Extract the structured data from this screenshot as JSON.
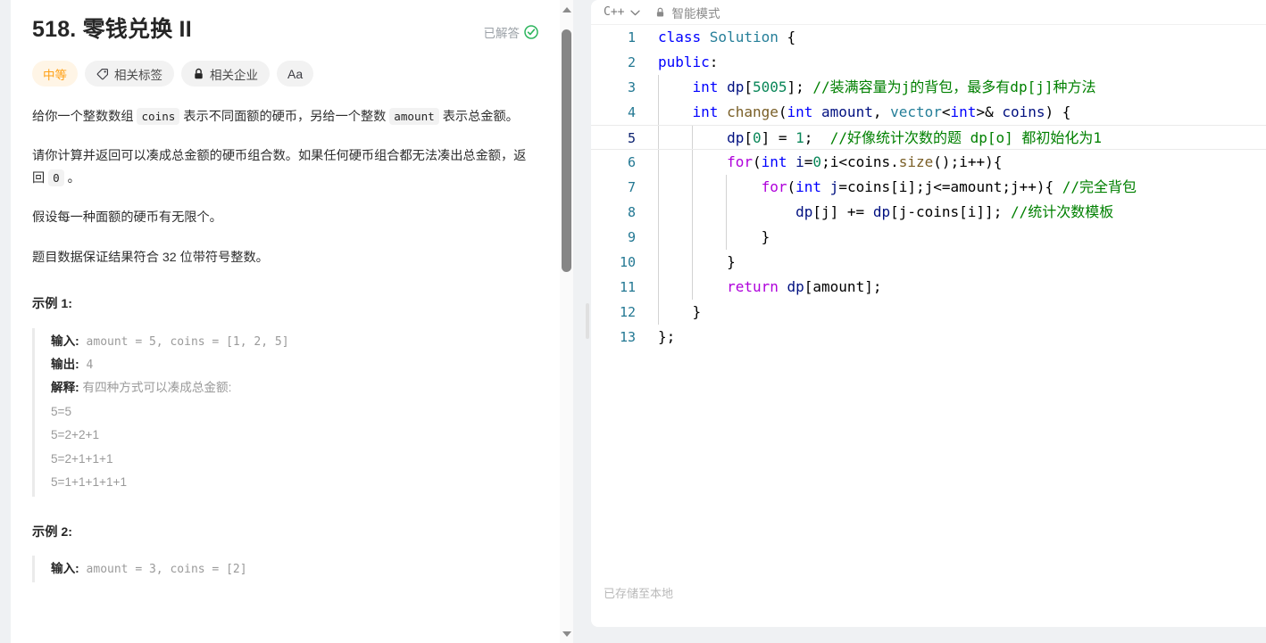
{
  "problem": {
    "title": "518. 零钱兑换 II",
    "solved_label": "已解答",
    "pills": {
      "difficulty": "中等",
      "tags": "相关标签",
      "companies": "相关企业",
      "font": "Aa"
    },
    "description": [
      {
        "parts": [
          {
            "t": "给你一个整数数组 ",
            "code": false
          },
          {
            "t": "coins",
            "code": true
          },
          {
            "t": " 表示不同面额的硬币，另给一个整数 ",
            "code": false
          },
          {
            "t": "amount",
            "code": true
          },
          {
            "t": " 表示总金额。",
            "code": false
          }
        ]
      },
      {
        "parts": [
          {
            "t": "请你计算并返回可以凑成总金额的硬币组合数。如果任何硬币组合都无法凑出总金额，返回 ",
            "code": false
          },
          {
            "t": "0",
            "code": true
          },
          {
            "t": " 。",
            "code": false
          }
        ]
      },
      {
        "parts": [
          {
            "t": "假设每一种面额的硬币有无限个。",
            "code": false
          }
        ]
      },
      {
        "parts": [
          {
            "t": "题目数据保证结果符合 32 位带符号整数。",
            "code": false
          }
        ]
      }
    ],
    "examples": [
      {
        "heading": "示例 1:",
        "lines": [
          {
            "label": "输入:",
            "value": " amount = 5, coins = [1, 2, 5]",
            "mono": true
          },
          {
            "label": "输出:",
            "value": " 4",
            "mono": true
          },
          {
            "label": "解释:",
            "value": " 有四种方式可以凑成总金额:",
            "mono": false
          },
          {
            "label": "",
            "value": "5=5",
            "mono": false
          },
          {
            "label": "",
            "value": "5=2+2+1",
            "mono": false
          },
          {
            "label": "",
            "value": "5=2+1+1+1",
            "mono": false
          },
          {
            "label": "",
            "value": "5=1+1+1+1+1",
            "mono": false
          }
        ]
      },
      {
        "heading": "示例 2:",
        "lines": [
          {
            "label": "输入:",
            "value": " amount = 3, coins = [2]",
            "mono": true
          }
        ]
      }
    ]
  },
  "editor": {
    "language": "C++",
    "smart_mode": "智能模式",
    "status": "已存储至本地",
    "active_line": 5,
    "lines": [
      {
        "n": "1",
        "guides": [],
        "tokens": [
          {
            "t": "class ",
            "c": "tok-key"
          },
          {
            "t": "Solution ",
            "c": "tok-class"
          },
          {
            "t": "{",
            "c": "tok-plain"
          }
        ]
      },
      {
        "n": "2",
        "guides": [],
        "tokens": [
          {
            "t": "public",
            "c": "tok-key"
          },
          {
            "t": ":",
            "c": "tok-plain"
          }
        ]
      },
      {
        "n": "3",
        "guides": [
          "g1"
        ],
        "tokens": [
          {
            "t": "    ",
            "c": "tok-plain"
          },
          {
            "t": "int ",
            "c": "tok-key"
          },
          {
            "t": "dp",
            "c": "tok-var"
          },
          {
            "t": "[",
            "c": "tok-plain"
          },
          {
            "t": "5005",
            "c": "tok-num"
          },
          {
            "t": "]; ",
            "c": "tok-plain"
          },
          {
            "t": "//装满容量为j的背包，最多有dp[j]种方法",
            "c": "tok-comment"
          }
        ]
      },
      {
        "n": "4",
        "guides": [
          "g1"
        ],
        "tokens": [
          {
            "t": "    ",
            "c": "tok-plain"
          },
          {
            "t": "int ",
            "c": "tok-key"
          },
          {
            "t": "change",
            "c": "tok-fn"
          },
          {
            "t": "(",
            "c": "tok-plain"
          },
          {
            "t": "int ",
            "c": "tok-key"
          },
          {
            "t": "amount",
            "c": "tok-var"
          },
          {
            "t": ", ",
            "c": "tok-plain"
          },
          {
            "t": "vector",
            "c": "tok-class"
          },
          {
            "t": "<",
            "c": "tok-plain"
          },
          {
            "t": "int",
            "c": "tok-key"
          },
          {
            "t": ">& ",
            "c": "tok-plain"
          },
          {
            "t": "coins",
            "c": "tok-var"
          },
          {
            "t": ") {",
            "c": "tok-plain"
          }
        ]
      },
      {
        "n": "5",
        "guides": [
          "g1",
          "g2"
        ],
        "tokens": [
          {
            "t": "        ",
            "c": "tok-plain"
          },
          {
            "t": "dp",
            "c": "tok-var"
          },
          {
            "t": "[",
            "c": "tok-plain"
          },
          {
            "t": "0",
            "c": "tok-num"
          },
          {
            "t": "] = ",
            "c": "tok-plain"
          },
          {
            "t": "1",
            "c": "tok-num"
          },
          {
            "t": ";  ",
            "c": "tok-plain"
          },
          {
            "t": "//好像统计次数的题 dp[o] 都初始化为1",
            "c": "tok-comment"
          }
        ]
      },
      {
        "n": "6",
        "guides": [
          "g1",
          "g2"
        ],
        "tokens": [
          {
            "t": "        ",
            "c": "tok-plain"
          },
          {
            "t": "for",
            "c": "tok-ctrl"
          },
          {
            "t": "(",
            "c": "tok-plain"
          },
          {
            "t": "int ",
            "c": "tok-key"
          },
          {
            "t": "i",
            "c": "tok-var"
          },
          {
            "t": "=",
            "c": "tok-plain"
          },
          {
            "t": "0",
            "c": "tok-num"
          },
          {
            "t": ";i<coins.",
            "c": "tok-plain"
          },
          {
            "t": "size",
            "c": "tok-fn"
          },
          {
            "t": "();i++){",
            "c": "tok-plain"
          }
        ]
      },
      {
        "n": "7",
        "guides": [
          "g1",
          "g2",
          "g3"
        ],
        "tokens": [
          {
            "t": "            ",
            "c": "tok-plain"
          },
          {
            "t": "for",
            "c": "tok-ctrl"
          },
          {
            "t": "(",
            "c": "tok-plain"
          },
          {
            "t": "int ",
            "c": "tok-key"
          },
          {
            "t": "j",
            "c": "tok-var"
          },
          {
            "t": "=coins[i];j<=amount;j++){ ",
            "c": "tok-plain"
          },
          {
            "t": "//完全背包",
            "c": "tok-comment"
          }
        ]
      },
      {
        "n": "8",
        "guides": [
          "g1",
          "g2",
          "g3"
        ],
        "tokens": [
          {
            "t": "                ",
            "c": "tok-plain"
          },
          {
            "t": "dp",
            "c": "tok-var"
          },
          {
            "t": "[j] += ",
            "c": "tok-plain"
          },
          {
            "t": "dp",
            "c": "tok-var"
          },
          {
            "t": "[j-coins[i]]; ",
            "c": "tok-plain"
          },
          {
            "t": "//统计次数模板",
            "c": "tok-comment"
          }
        ]
      },
      {
        "n": "9",
        "guides": [
          "g1",
          "g2",
          "g3"
        ],
        "tokens": [
          {
            "t": "            }",
            "c": "tok-plain"
          }
        ]
      },
      {
        "n": "10",
        "guides": [
          "g1",
          "g2"
        ],
        "tokens": [
          {
            "t": "        }",
            "c": "tok-plain"
          }
        ]
      },
      {
        "n": "11",
        "guides": [
          "g1",
          "g2"
        ],
        "tokens": [
          {
            "t": "        ",
            "c": "tok-plain"
          },
          {
            "t": "return ",
            "c": "tok-ctrl"
          },
          {
            "t": "dp",
            "c": "tok-var"
          },
          {
            "t": "[amount];",
            "c": "tok-plain"
          }
        ]
      },
      {
        "n": "12",
        "guides": [
          "g1"
        ],
        "tokens": [
          {
            "t": "    }",
            "c": "tok-plain"
          }
        ]
      },
      {
        "n": "13",
        "guides": [],
        "tokens": [
          {
            "t": "};",
            "c": "tok-plain"
          }
        ]
      }
    ]
  },
  "colors": {
    "difficulty_orange": "#ffa116",
    "solved_green": "#2db55d",
    "keyword_blue": "#0000ff",
    "comment_green": "#008000",
    "control_purple": "#af00db",
    "number_green": "#098658",
    "type_teal": "#267f99"
  }
}
